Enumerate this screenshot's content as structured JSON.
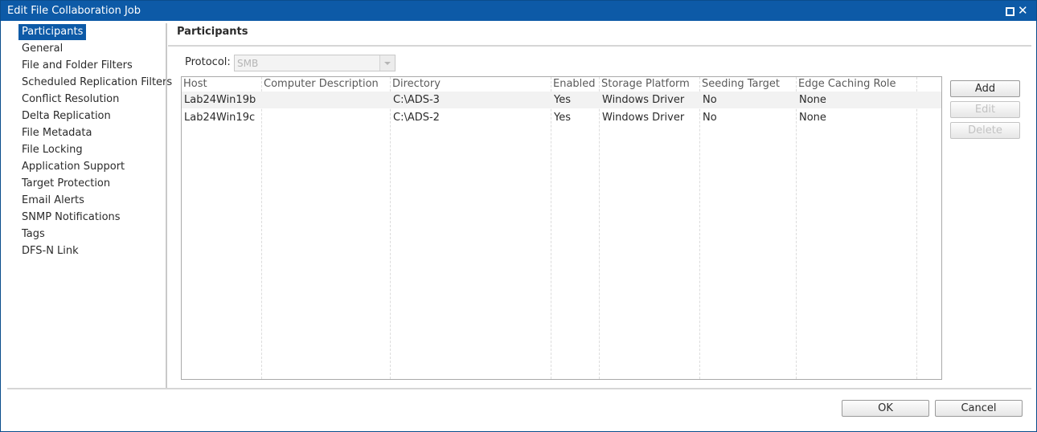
{
  "window": {
    "title": "Edit File Collaboration Job"
  },
  "sidebar": {
    "items": [
      {
        "label": "Participants",
        "selected": true
      },
      {
        "label": "General"
      },
      {
        "label": "File and Folder Filters"
      },
      {
        "label": "Scheduled Replication Filters"
      },
      {
        "label": "Conflict Resolution"
      },
      {
        "label": "Delta Replication"
      },
      {
        "label": "File Metadata"
      },
      {
        "label": "File Locking"
      },
      {
        "label": "Application Support"
      },
      {
        "label": "Target Protection"
      },
      {
        "label": "Email Alerts"
      },
      {
        "label": "SNMP Notifications"
      },
      {
        "label": "Tags"
      },
      {
        "label": "DFS-N Link"
      }
    ]
  },
  "main": {
    "title": "Participants",
    "protocol": {
      "label": "Protocol:",
      "value": "SMB"
    },
    "table": {
      "columns": [
        "Host",
        "Computer Description",
        "Directory",
        "Enabled",
        "Storage Platform",
        "Seeding Target",
        "Edge Caching Role"
      ],
      "rows": [
        [
          "Lab24Win19b",
          "",
          "C:\\ADS-3",
          "Yes",
          "Windows Driver",
          "No",
          "None"
        ],
        [
          "Lab24Win19c",
          "",
          "C:\\ADS-2",
          "Yes",
          "Windows Driver",
          "No",
          "None"
        ]
      ]
    },
    "buttons": {
      "add": "Add",
      "edit": "Edit",
      "delete": "Delete"
    }
  },
  "footer": {
    "ok": "OK",
    "cancel": "Cancel"
  },
  "colors": {
    "accent": "#0d5aa7",
    "selected_row": "#f2f2f2"
  },
  "icons": {
    "maximize": "maximize-icon",
    "close": "close-icon",
    "dropdown": "chevron-down-icon"
  }
}
